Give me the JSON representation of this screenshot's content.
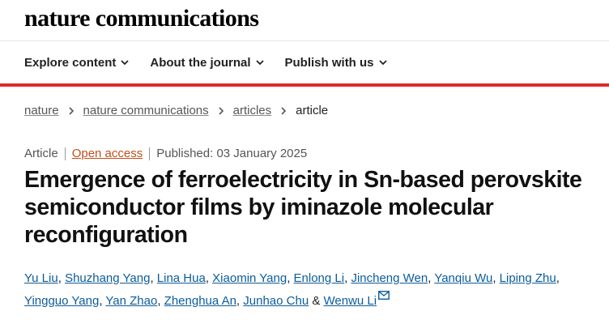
{
  "header": {
    "brand": "nature communications"
  },
  "nav": {
    "items": [
      {
        "label": "Explore content"
      },
      {
        "label": "About the journal"
      },
      {
        "label": "Publish with us"
      }
    ]
  },
  "breadcrumb": {
    "items": [
      {
        "label": "nature"
      },
      {
        "label": "nature communications"
      },
      {
        "label": "articles"
      }
    ],
    "current": "article"
  },
  "article": {
    "type": "Article",
    "access": "Open access",
    "published": "Published: 03 January 2025",
    "title": "Emergence of ferroelectricity in Sn-based perovskite semiconductor films by iminazole molecular reconfiguration",
    "authors": [
      "Yu Liu",
      "Shuzhang Yang",
      "Lina Hua",
      "Xiaomin Yang",
      "Enlong Li",
      "Jincheng Wen",
      "Yanqiu Wu",
      "Liping Zhu",
      "Yingguo Yang",
      "Yan Zhao",
      "Zhenghua An",
      "Junhao Chu",
      "Wenwu Li"
    ],
    "author_separator": ", ",
    "author_last_joiner": " & "
  },
  "colors": {
    "accent_bar": "#e0292a",
    "link": "#0c5c9c",
    "open_access": "#c0501c"
  },
  "icons": {
    "nav_chevron": "chevron-down-icon",
    "breadcrumb_separator": "chevron-right-icon",
    "corresponding_author": "mail-icon"
  }
}
